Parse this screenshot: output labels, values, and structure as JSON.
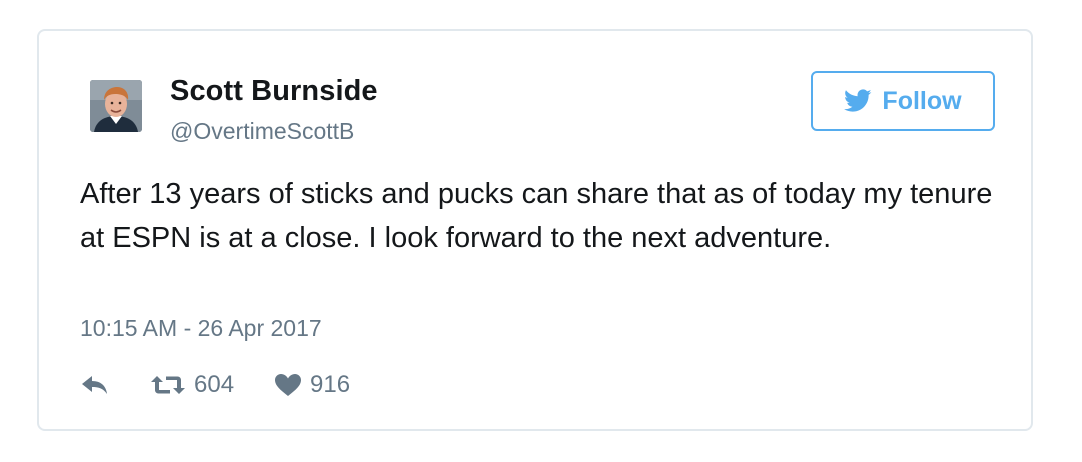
{
  "tweet": {
    "author": {
      "display_name": "Scott Burnside",
      "handle": "@OvertimeScottB",
      "avatar_icon": "profile-photo"
    },
    "follow_button": {
      "label": "Follow",
      "icon": "twitter-bird-icon",
      "color": "#55acee"
    },
    "text": "After 13 years of sticks and pucks can share that as of today my tenure at ESPN is at a close. I look forward to the next adventure.",
    "timestamp": "10:15 AM - 26 Apr 2017",
    "actions": {
      "reply_icon": "reply-icon",
      "retweet_icon": "retweet-icon",
      "retweet_count": "604",
      "like_icon": "heart-icon",
      "like_count": "916"
    }
  }
}
